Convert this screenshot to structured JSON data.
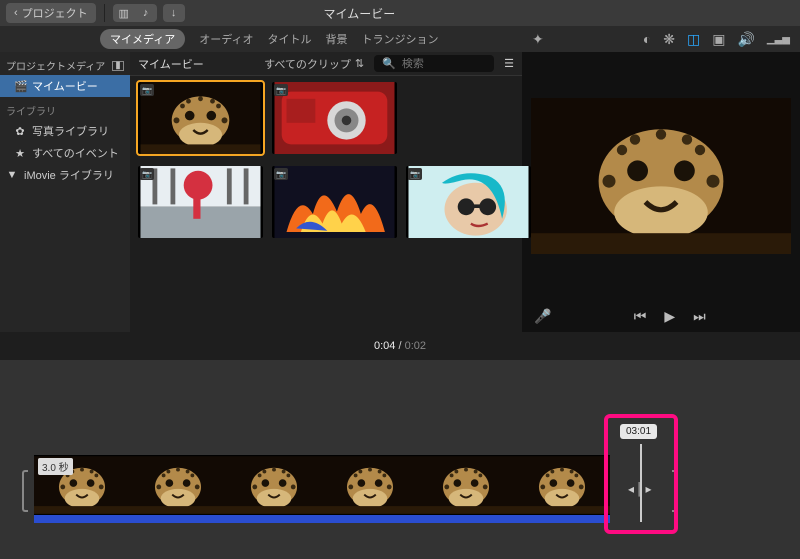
{
  "topbar": {
    "back_label": "プロジェクト",
    "title": "マイムービー"
  },
  "tabs": {
    "my_media": "マイメディア",
    "audio": "オーディオ",
    "titles": "タイトル",
    "backgrounds": "背景",
    "transitions": "トランジション"
  },
  "sidebar": {
    "header": "プロジェクトメディア",
    "project_movie": "マイムービー",
    "library_header": "ライブラリ",
    "photo_library": "写真ライブラリ",
    "all_events": "すべてのイベント",
    "imovie_library": "iMovie ライブラリ"
  },
  "browser": {
    "title": "マイムービー",
    "all_clips": "すべてのクリップ",
    "search_placeholder": "検索"
  },
  "timecode": {
    "current": "0:04",
    "total": "0:02"
  },
  "timeline": {
    "clip_duration_badge": "3.0 秒",
    "trim_tooltip": "03:01"
  },
  "icons": {
    "back": "chevron-left-icon",
    "wand": "magic-wand-icon",
    "color_balance": "color-balance-icon",
    "color_wheel": "color-wheel-icon",
    "crop": "crop-icon",
    "stabilize": "stabilize-icon",
    "volume": "volume-icon",
    "equalizer": "equalizer-icon",
    "mic": "microphone-icon",
    "prev": "skip-back-icon",
    "play": "play-icon",
    "next": "skip-forward-icon"
  }
}
